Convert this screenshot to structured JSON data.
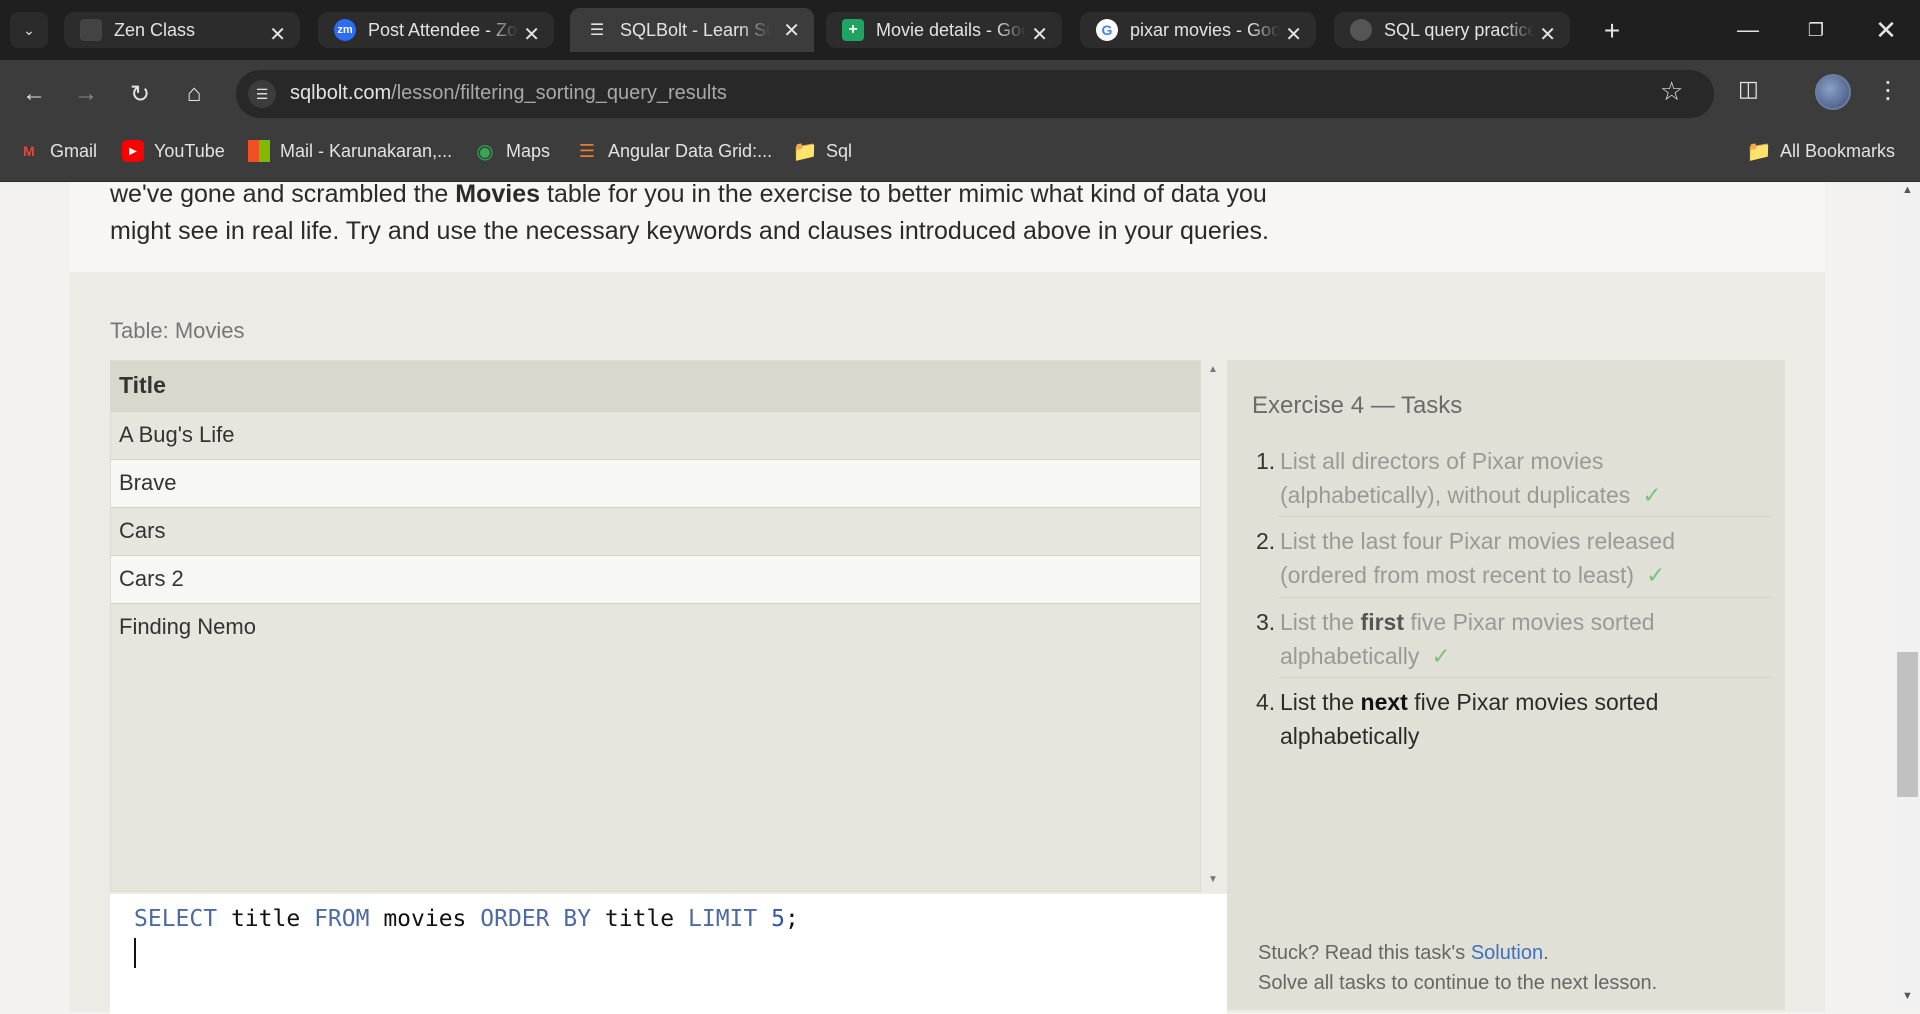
{
  "browser": {
    "tabs": [
      {
        "title": "Zen Class",
        "active": false
      },
      {
        "title": "Post Attendee - Zoom",
        "active": false
      },
      {
        "title": "SQLBolt - Learn SQL",
        "active": true
      },
      {
        "title": "Movie details - Google Sheets",
        "active": false
      },
      {
        "title": "pixar movies - Google Search",
        "active": false
      },
      {
        "title": "SQL query practice",
        "active": false
      }
    ],
    "url": {
      "domain": "sqlbolt.com",
      "path": "/lesson/filtering_sorting_query_results"
    },
    "bookmarks": [
      "Gmail",
      "YouTube",
      "Mail - Karunakaran,...",
      "Maps",
      "Angular Data Grid:...",
      "Sql"
    ],
    "all_bookmarks": "All Bookmarks",
    "favicon_zoom": "zm"
  },
  "page": {
    "intro_line1_pre": "we've gone and scrambled the",
    "intro_bold": "Movies",
    "intro_line1_post": "table for you in the exercise to better mimic what kind of data you",
    "intro_line2": "might see in real life. Try and use the necessary keywords and clauses introduced above in your queries.",
    "table_caption": "Table: Movies",
    "results": {
      "columns": [
        "Title"
      ],
      "rows": [
        "A Bug's Life",
        "Brave",
        "Cars",
        "Cars 2",
        "Finding Nemo"
      ]
    },
    "query": {
      "kw_select": "SELECT",
      "col1": "title",
      "kw_from": "FROM",
      "table": "movies",
      "kw_order": "ORDER BY",
      "col2": "title",
      "kw_limit": "LIMIT",
      "limit_value": "5",
      "terminator": ";"
    },
    "tasks": {
      "title": "Exercise 4 — Tasks",
      "items": [
        {
          "num": "1.",
          "line1": "List all directors of Pixar movies",
          "line2": "(alphabetically), without duplicates",
          "done": true
        },
        {
          "num": "2.",
          "line1": "List the last four Pixar movies released",
          "line2": "(ordered from most recent to least)",
          "done": true
        },
        {
          "num": "3.",
          "pre": "List the",
          "bold": "first",
          "post": "five Pixar movies sorted",
          "line2": "alphabetically",
          "done": true
        },
        {
          "num": "4.",
          "pre": "List the",
          "bold": "next",
          "post": "five Pixar movies sorted",
          "line2": "alphabetically",
          "done": false
        }
      ],
      "check_mark": "✓",
      "stuck_pre": "Stuck? Read this task's",
      "solution_link": "Solution",
      "stuck_post": ".",
      "solve_all": "Solve all tasks to continue to the next lesson."
    }
  },
  "colors": {
    "keyword": "#4c6ba5",
    "check": "#7ac47a",
    "link": "#3d6fc2"
  }
}
